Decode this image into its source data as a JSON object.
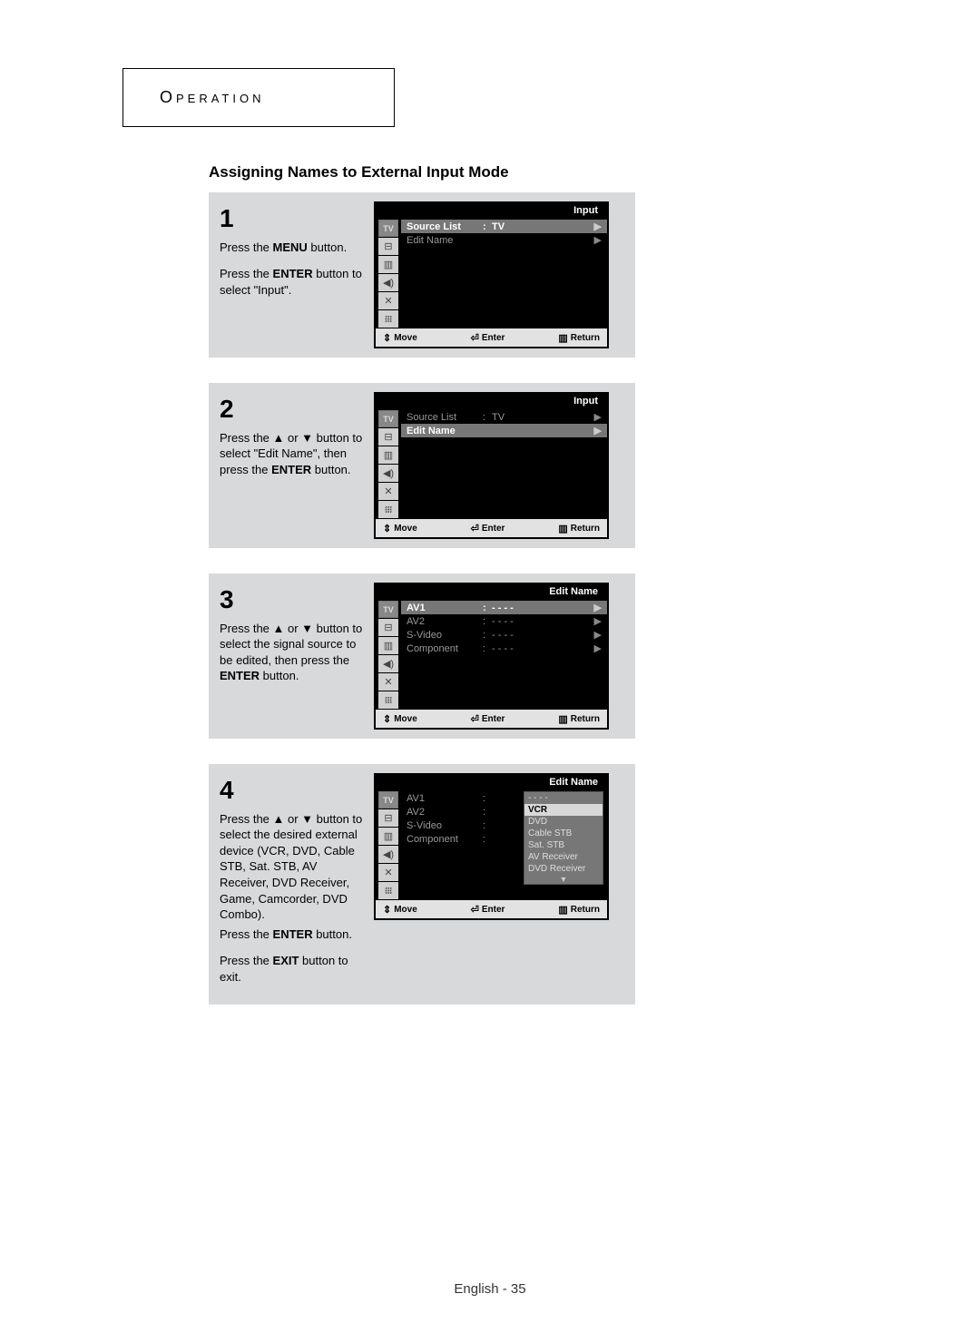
{
  "header": {
    "title": "Operation"
  },
  "heading": "Assigning Names to External Input Mode",
  "steps": {
    "s1": {
      "num": "1",
      "line1a": "Press the ",
      "line1b": "MENU",
      "line1c": " button.",
      "line2a": "Press the ",
      "line2b": "ENTER",
      "line2c": " button to select \"Input\"."
    },
    "s2": {
      "num": "2",
      "line1a": "Press the ▲ or ▼ button to select \"Edit Name\", then press the ",
      "line1b": "ENTER",
      "line1c": " button."
    },
    "s3": {
      "num": "3",
      "line1a": "Press the ▲ or ▼ button to select the signal source to be edited, then press the ",
      "line1b": "ENTER",
      "line1c": " button."
    },
    "s4": {
      "num": "4",
      "line1a": "Press the ▲ or ▼ button to select the desired external device (VCR, DVD, Cable STB, Sat. STB, AV Receiver, DVD Receiver, Game, Camcorder, DVD Combo).",
      "line2a": "Press the ",
      "line2b": "ENTER",
      "line2c": " button.",
      "line3a": "Press the ",
      "line3b": "EXIT",
      "line3c": " button to exit."
    }
  },
  "osd1": {
    "tabTV": "TV",
    "title": "Input",
    "rows": [
      {
        "label": "Source List",
        "val": "TV",
        "hl": true
      },
      {
        "label": "Edit Name",
        "val": "",
        "hl": false
      }
    ]
  },
  "osd2": {
    "tabTV": "TV",
    "title": "Input",
    "rows": [
      {
        "label": "Source List",
        "val": "TV",
        "hl": false
      },
      {
        "label": "Edit Name",
        "val": "",
        "hl": true
      }
    ]
  },
  "osd3": {
    "tabTV": "TV",
    "title": "Edit Name",
    "rows": [
      {
        "label": "AV1",
        "val": "- - - -",
        "hl": true
      },
      {
        "label": "AV2",
        "val": "- - - -",
        "hl": false
      },
      {
        "label": "S-Video",
        "val": "- - - -",
        "hl": false
      },
      {
        "label": "Component",
        "val": "- - - -",
        "hl": false
      }
    ]
  },
  "osd4": {
    "tabTV": "TV",
    "title": "Edit Name",
    "rows": [
      {
        "label": "AV1",
        "val": "",
        "hl": false
      },
      {
        "label": "AV2",
        "val": "",
        "hl": false
      },
      {
        "label": "S-Video",
        "val": "",
        "hl": false
      },
      {
        "label": "Component",
        "val": "",
        "hl": false
      }
    ],
    "popup": {
      "top": "- - - -",
      "items": [
        "VCR",
        "DVD",
        "Cable STB",
        "Sat. STB",
        "AV Receiver",
        "DVD Receiver"
      ],
      "selected": "VCR"
    }
  },
  "osdBottom": {
    "move": "Move",
    "enter": "Enter",
    "return": "Return"
  },
  "icons": {
    "tv": "TV",
    "input": "⊟",
    "picture": "▥",
    "sound": "◀)",
    "channel": "✕",
    "setup": "᎒᎒᎒"
  },
  "footer": {
    "lang": "English",
    "page": "35"
  }
}
